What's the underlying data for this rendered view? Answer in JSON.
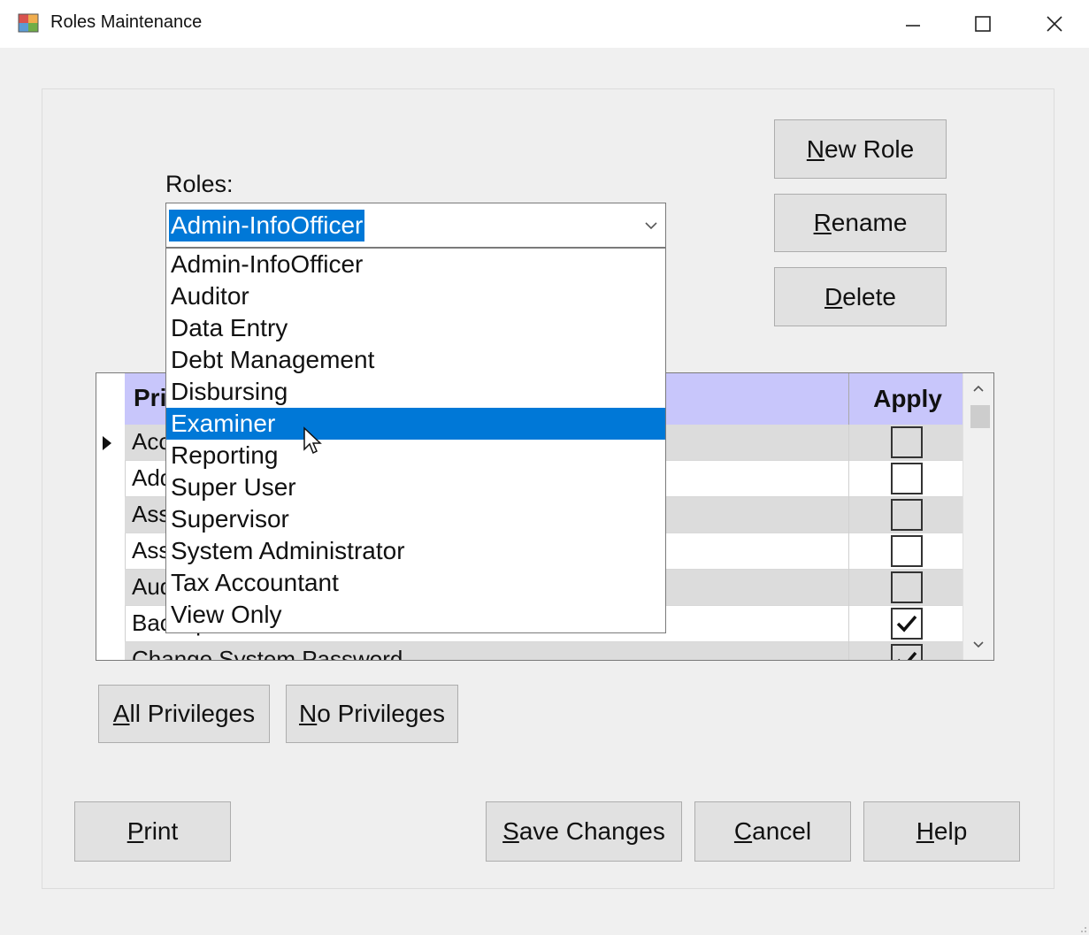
{
  "window": {
    "title": "Roles Maintenance",
    "icon": "app-window-icon",
    "controls": [
      "minimize-icon",
      "maximize-icon",
      "close-icon"
    ]
  },
  "roles": {
    "label": "Roles:",
    "selected_value": "Admin-InfoOfficer",
    "options": [
      "Admin-InfoOfficer",
      "Auditor",
      "Data Entry",
      "Debt Management",
      "Disbursing",
      "Examiner",
      "Reporting",
      "Super User",
      "Supervisor",
      "System Administrator",
      "Tax Accountant",
      "View Only"
    ],
    "highlighted_option": "Examiner"
  },
  "role_buttons": {
    "new_role": {
      "ul": "N",
      "rest": "ew Role"
    },
    "rename": {
      "ul": "R",
      "rest": "ename"
    },
    "delete": {
      "ul": "D",
      "rest": "elete"
    }
  },
  "grid": {
    "columns": {
      "privilege": "Pri",
      "apply": "Apply"
    },
    "rows": [
      {
        "text": "Acc",
        "checked": false
      },
      {
        "text": "Add",
        "checked": false
      },
      {
        "text": "Ass",
        "checked": false
      },
      {
        "text": "Ass",
        "checked": false
      },
      {
        "text": "Aud",
        "checked": false
      },
      {
        "text": "Backup Database",
        "checked": true
      },
      {
        "text": "Change System Password",
        "checked": true
      }
    ]
  },
  "privilege_buttons": {
    "all": {
      "ul": "A",
      "rest": "ll Privileges"
    },
    "none": {
      "ul": "N",
      "rest": "o Privileges"
    }
  },
  "bottom_buttons": {
    "print": {
      "ul": "P",
      "rest": "rint"
    },
    "save": {
      "ul": "S",
      "rest": "ave Changes"
    },
    "cancel": {
      "ul": "C",
      "rest": "ancel"
    },
    "help": {
      "ul": "H",
      "rest": "elp"
    }
  },
  "colors": {
    "selection": "#0078d7",
    "grid_header": "#c8c6fb",
    "button_face": "#e1e1e1"
  }
}
